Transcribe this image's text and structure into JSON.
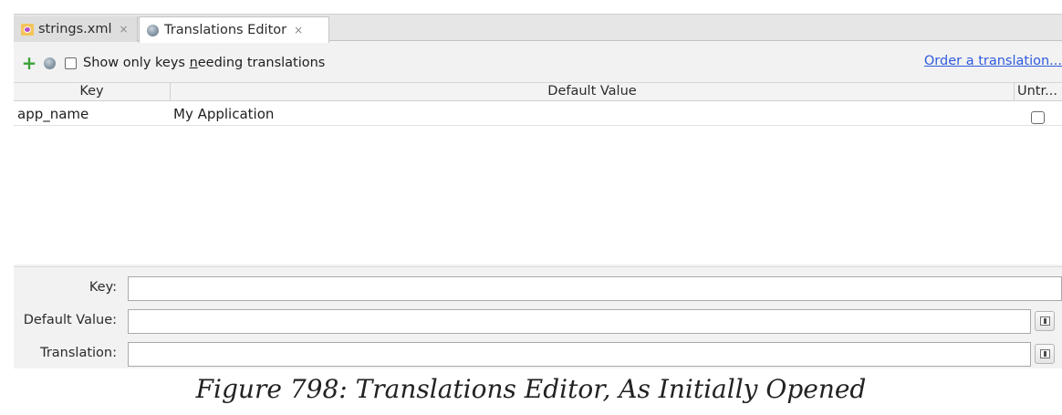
{
  "tabs": [
    {
      "label": "strings.xml",
      "icon": "xml-file-icon",
      "close": "×"
    },
    {
      "label": "Translations Editor",
      "icon": "globe-icon",
      "close": "×"
    }
  ],
  "toolbar": {
    "add_icon": "plus-icon",
    "globe_icon": "globe-icon",
    "filter_label_prefix": "Show only keys ",
    "filter_label_mnemonic": "n",
    "filter_label_suffix": "eeding translations",
    "filter_checked": false,
    "order_link": "Order a translation..."
  },
  "table": {
    "columns": [
      "Key",
      "Default Value",
      "Untr..."
    ],
    "rows": [
      {
        "key": "app_name",
        "default_value": "My Application",
        "untranslatable": false
      }
    ]
  },
  "form": {
    "key_label": "Key:",
    "key_value": "",
    "default_label": "Default Value:",
    "default_value": "",
    "translation_label": "Translation:",
    "translation_value": ""
  },
  "caption": "Figure 798: Translations Editor, As Initially Opened",
  "colors": {
    "link": "#2f5bde",
    "add": "#3aa33a"
  }
}
